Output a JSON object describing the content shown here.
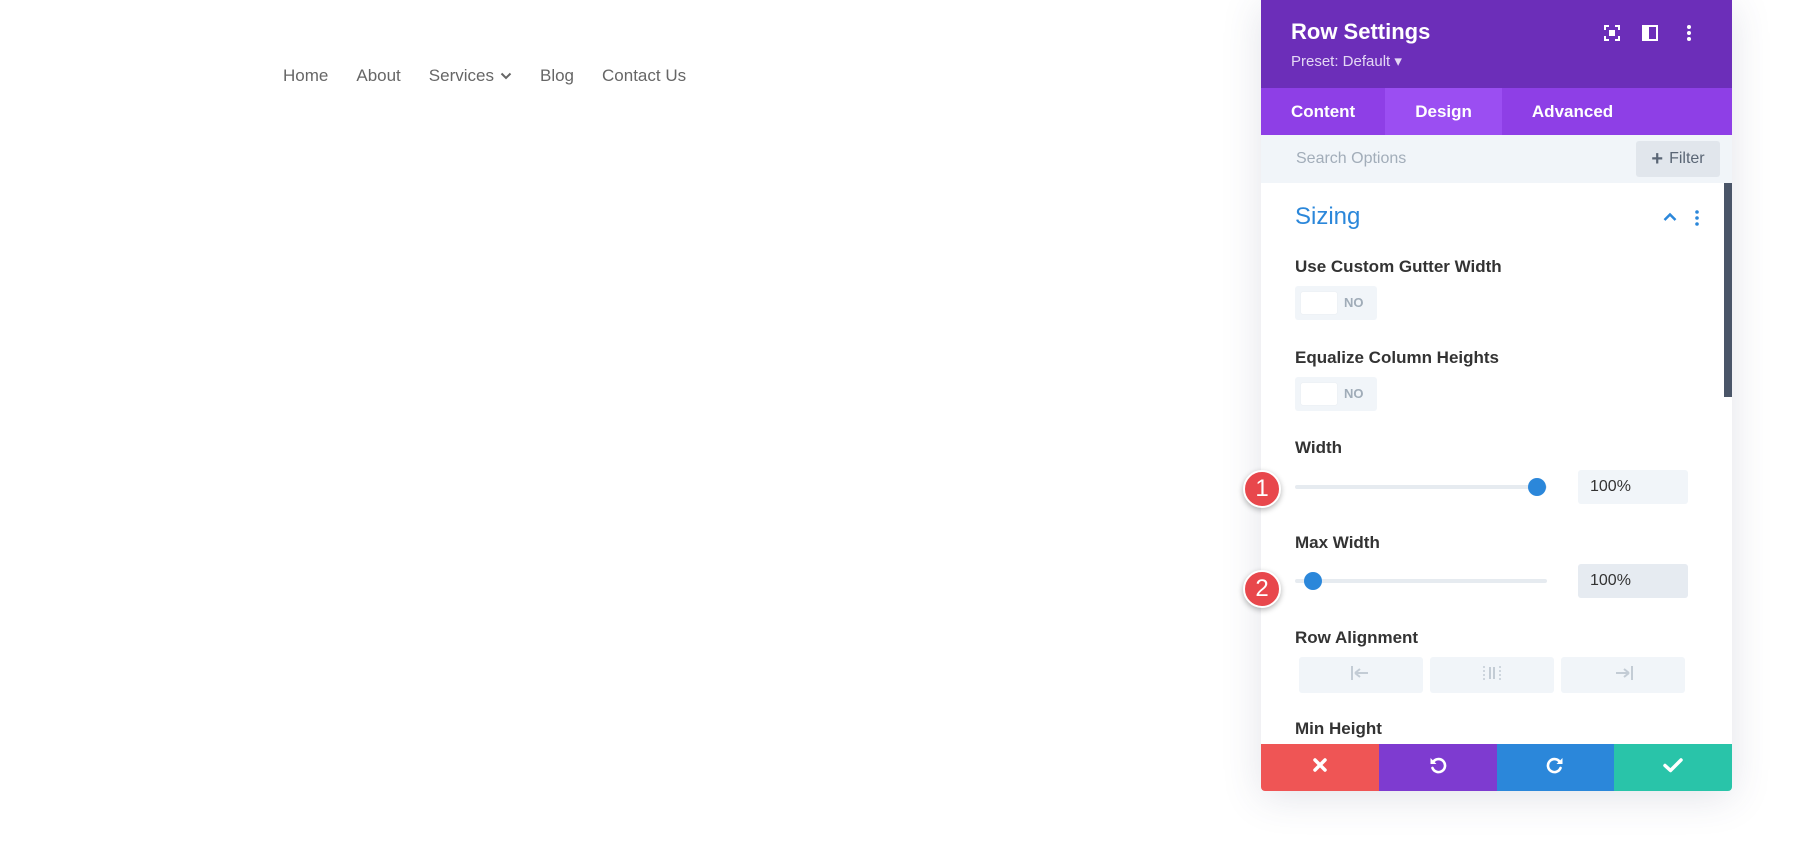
{
  "nav": {
    "items": [
      {
        "label": "Home"
      },
      {
        "label": "About"
      },
      {
        "label": "Services",
        "has_dropdown": true
      },
      {
        "label": "Blog"
      },
      {
        "label": "Contact Us"
      }
    ]
  },
  "panel": {
    "title": "Row Settings",
    "preset": "Preset: Default ▾",
    "header_icons": [
      "screenshot-icon",
      "split-view-icon",
      "more-vertical-icon"
    ],
    "tabs": [
      {
        "label": "Content",
        "active": false
      },
      {
        "label": "Design",
        "active": true
      },
      {
        "label": "Advanced",
        "active": false
      }
    ],
    "search": {
      "placeholder": "Search Options",
      "value": ""
    },
    "filter_label": "Filter",
    "section": {
      "title": "Sizing",
      "options": {
        "gutter": {
          "label": "Use Custom Gutter Width",
          "toggle_text": "NO",
          "enabled": false
        },
        "equalize": {
          "label": "Equalize Column Heights",
          "toggle_text": "NO",
          "enabled": false
        },
        "width": {
          "label": "Width",
          "value": "100%",
          "slider_level": 0.96
        },
        "max_width": {
          "label": "Max Width",
          "value": "100%",
          "slider_level": 0.07
        },
        "row_alignment": {
          "label": "Row Alignment",
          "buttons": [
            "align-left-icon",
            "align-center-icon",
            "align-right-icon"
          ]
        },
        "min_height": {
          "label": "Min Height"
        }
      }
    },
    "footer": {
      "cancel_color": "#ef5555",
      "undo_color": "#7e3bd0",
      "redo_color": "#2b87da",
      "save_color": "#29c4a9"
    }
  },
  "callouts": [
    {
      "number": "1"
    },
    {
      "number": "2"
    }
  ],
  "colors": {
    "header": "#6c2eb9",
    "tabs": "#8e3fe6",
    "accent": "#2b87da",
    "callout": "#e8474c"
  }
}
